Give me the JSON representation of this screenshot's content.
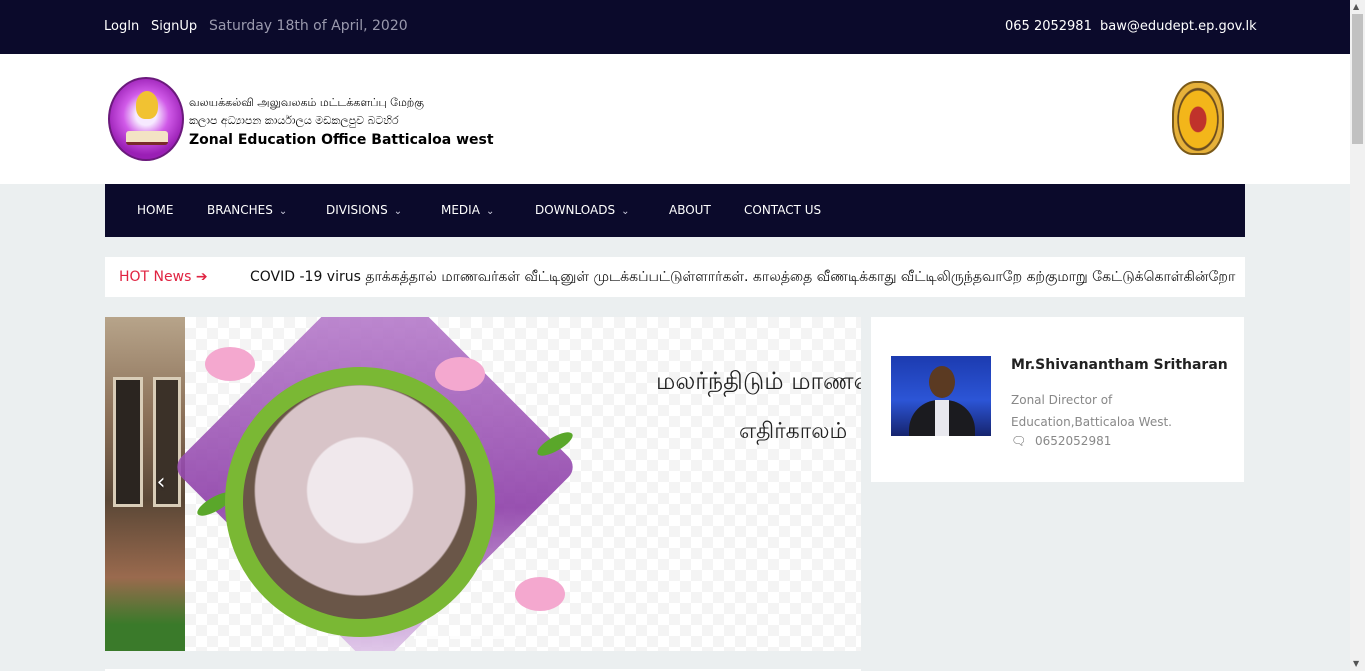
{
  "topbar": {
    "login": "LogIn",
    "signup": "SignUp",
    "date": "Saturday 18th of April, 2020",
    "phone": "065 2052981",
    "email": "baw@edudept.ep.gov.lk"
  },
  "header": {
    "org_line_1": "வலயக்கல்வி அலுவலகம் மட்டக்களப்பு மேற்கு",
    "org_line_2": "කලාප අධ්‍යාපන කාර්යාලය මඩකලපුව බටහිර",
    "org_line_3": "Zonal Education Office Batticaloa west",
    "logo_icon": "zonal-education-logo",
    "emblem_icon": "sri-lanka-emblem"
  },
  "nav": {
    "items": [
      {
        "label": "HOME",
        "dropdown": false
      },
      {
        "label": "BRANCHES",
        "dropdown": true
      },
      {
        "label": "DIVISIONS",
        "dropdown": true
      },
      {
        "label": "MEDIA",
        "dropdown": true
      },
      {
        "label": "DOWNLOADS",
        "dropdown": true
      },
      {
        "label": "ABOUT",
        "dropdown": false
      },
      {
        "label": "CONTACT US",
        "dropdown": false
      }
    ],
    "chevron": "⌄"
  },
  "hot_news": {
    "label": "HOT News",
    "arrow": "➔",
    "text": "COVID -19 virus தாக்கத்தால் மாணவர்கள் வீட்டினுள் முடக்கப்பட்டுள்ளார்கள். காலத்தை வீணடிக்காது வீட்டிலிருந்தவாறே கற்குமாறு கேட்டுக்கொள்கின்றோ"
  },
  "slider": {
    "title_line_1": "மலர்ந்திடும் மாணவர்கள்",
    "title_line_2": "எதிர்காலம்",
    "prev_icon": "‹",
    "indicator_count": 3,
    "active_indicator": 0
  },
  "director": {
    "name": "Mr.Shivanantham Sritharan",
    "title": "Zonal Director of Education,Batticaloa West.",
    "phone": "0652052981",
    "phone_icon": "chat-icon"
  },
  "colors": {
    "topbar_bg": "#0b0a2b",
    "nav_bg": "#0b0a2b",
    "hot_label": "#e02341",
    "page_bg": "#ebeff0"
  }
}
